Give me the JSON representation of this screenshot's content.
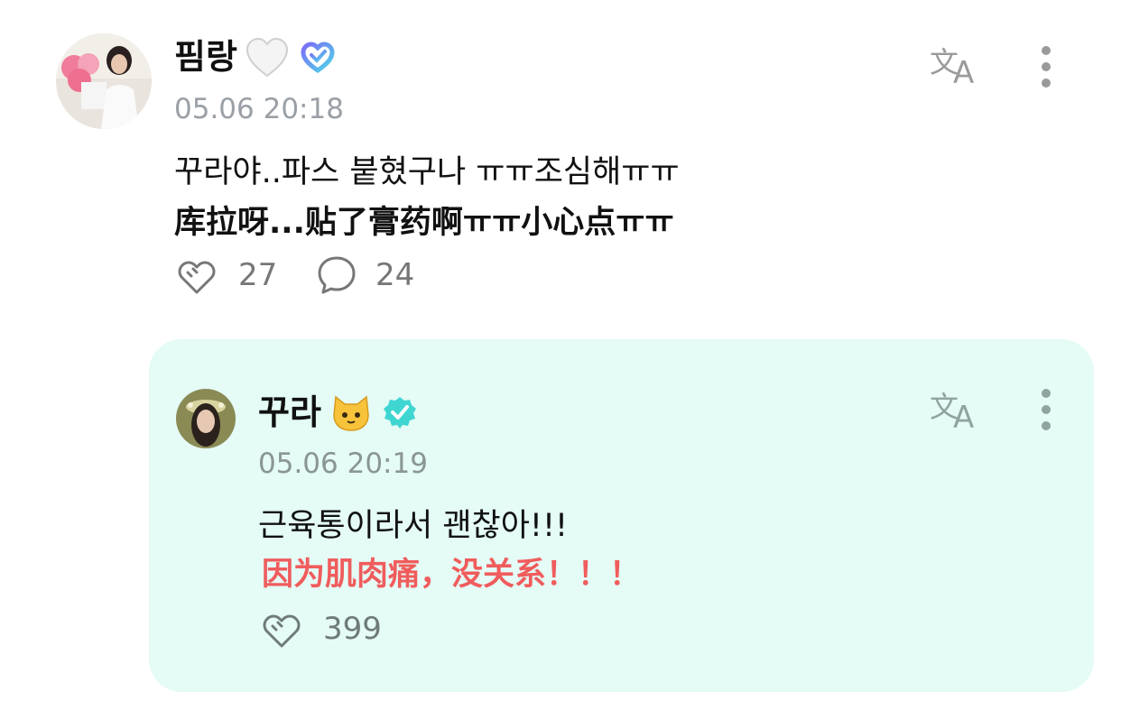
{
  "comment": {
    "author": "핌랑",
    "heart_emoji": "white-heart",
    "badge_icon": "fan-badge-icon",
    "timestamp": "05.06 20:18",
    "text_korean": "꾸라야..파스 붙혔구나 ㅠㅠ조심해ㅠㅠ",
    "text_chinese": "库拉呀...贴了膏药啊ㅠㅠ小心点ㅠㅠ",
    "likes": "27",
    "replies": "24"
  },
  "reply": {
    "author": "꾸라",
    "emoji": "🐱",
    "verified_icon": "verified-check-icon",
    "timestamp": "05.06 20:19",
    "text_korean": "근육통이라서 괜찮아!!!",
    "text_chinese": "因为肌肉痛，没关系！！！",
    "likes": "399"
  },
  "colors": {
    "reply_background": "#e4fbf6",
    "chinese_reply_text": "#f05c5c",
    "timestamp": "#9aa0a6",
    "verified": "#3fd6d2"
  }
}
